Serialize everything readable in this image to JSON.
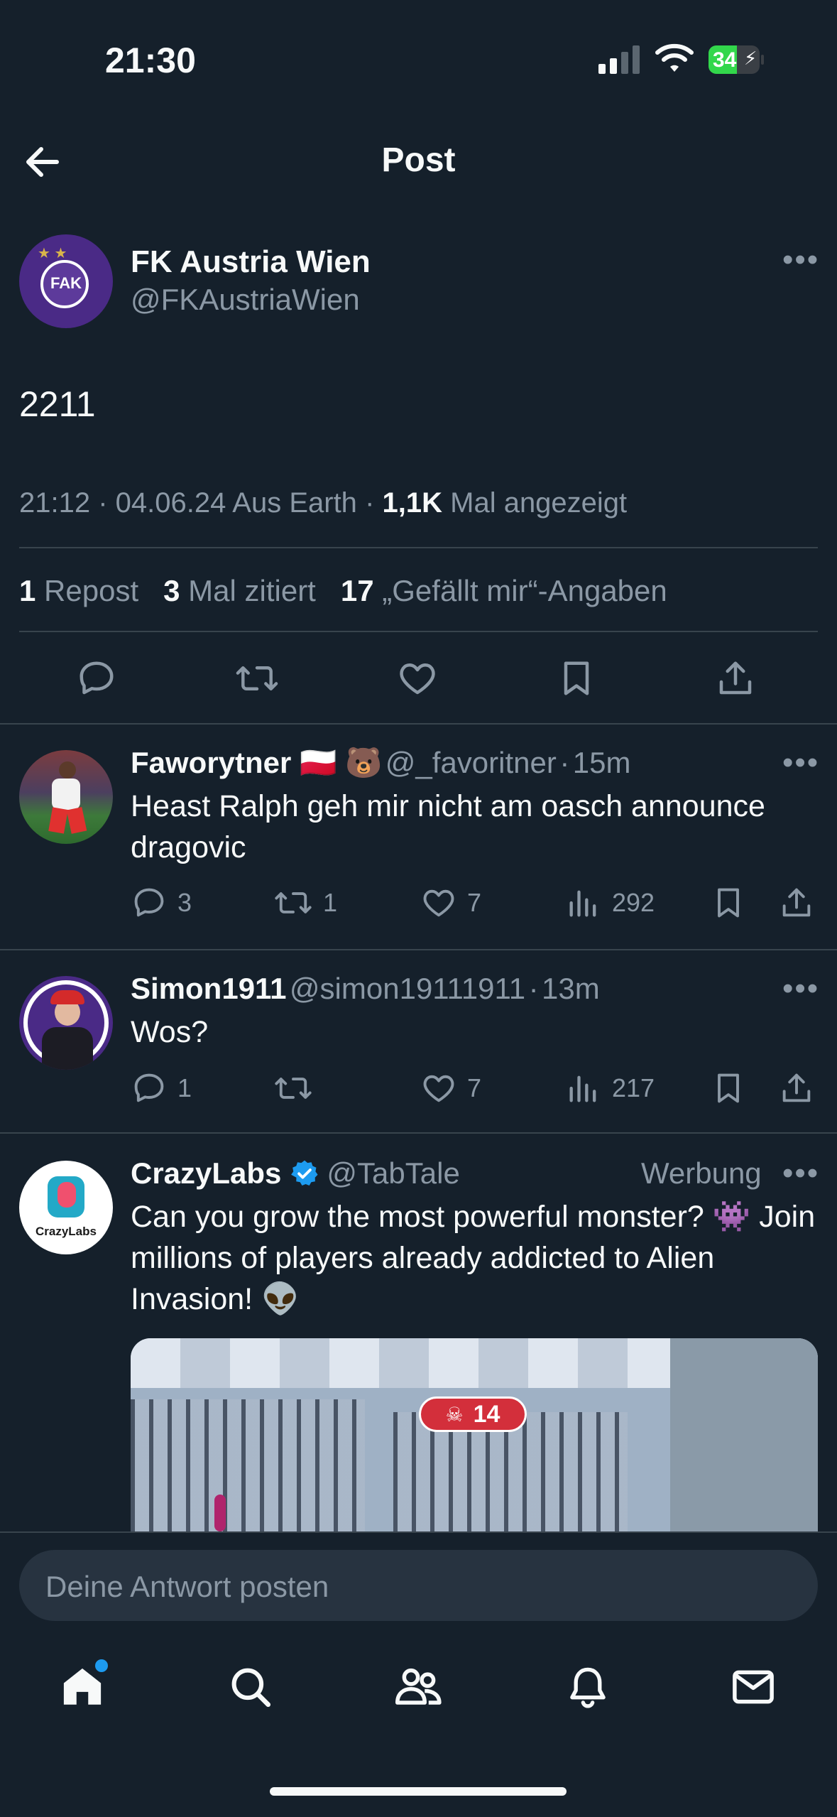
{
  "status_bar": {
    "time": "21:30",
    "battery": "34"
  },
  "header": {
    "title": "Post"
  },
  "post": {
    "author_name": "FK Austria Wien",
    "author_handle": "@FKAustriaWien",
    "text": "2211",
    "time": "21:12",
    "date": "04.06.24",
    "location": "Aus Earth",
    "views_count": "1,1K",
    "views_label": "Mal angezeigt",
    "reposts_count": "1",
    "reposts_label": "Repost",
    "quotes_count": "3",
    "quotes_label": "Mal zitiert",
    "likes_count": "17",
    "likes_label": "„Gefällt mir“-Angaben",
    "avatar_text": "FAK"
  },
  "replies": [
    {
      "name": "Faworytner 🇵🇱 🐻",
      "handle": "@_favoritner",
      "time": "15m",
      "text": "Heast Ralph geh mir nicht am oasch announce dragovic",
      "comments": "3",
      "reposts": "1",
      "likes": "7",
      "views": "292"
    },
    {
      "name": "Simon1911",
      "handle": "@simon19111911",
      "time": "13m",
      "text": "Wos?",
      "comments": "1",
      "reposts": "",
      "likes": "7",
      "views": "217"
    }
  ],
  "ad": {
    "name": "CrazyLabs",
    "handle": "@TabTale",
    "label": "Werbung",
    "text": "Can you grow the most powerful monster? 👾 Join millions of players already addicted to Alien Invasion! 👽",
    "avatar_text": "CrazyLabs",
    "media_badge": "14"
  },
  "reply_box": {
    "placeholder": "Deine Antwort posten"
  },
  "tab_bar": [
    "home-icon",
    "search-icon",
    "communities-icon",
    "notifications-icon",
    "messages-icon"
  ],
  "colors": {
    "background": "#15202b",
    "divider": "#38444d",
    "muted": "#8b98a5",
    "accent": "#1d9bf0",
    "verified": "#1d9bf0"
  }
}
